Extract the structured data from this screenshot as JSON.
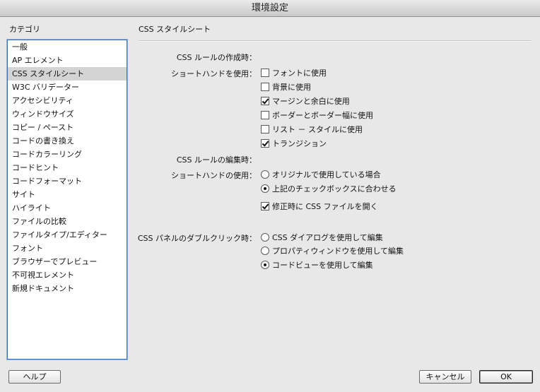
{
  "window": {
    "title": "環境設定"
  },
  "sidebar": {
    "label": "カテゴリ",
    "items": [
      {
        "label": "一般"
      },
      {
        "label": "AP エレメント"
      },
      {
        "label": "CSS スタイルシート"
      },
      {
        "label": "W3C バリデーター"
      },
      {
        "label": "アクセシビリティ"
      },
      {
        "label": "ウィンドウサイズ"
      },
      {
        "label": "コピー / ペースト"
      },
      {
        "label": "コードの書き換え"
      },
      {
        "label": "コードカラーリング"
      },
      {
        "label": "コードヒント"
      },
      {
        "label": "コードフォーマット"
      },
      {
        "label": "サイト"
      },
      {
        "label": "ハイライト"
      },
      {
        "label": "ファイルの比較"
      },
      {
        "label": "ファイルタイプ/エディター"
      },
      {
        "label": "フォント"
      },
      {
        "label": "ブラウザーでプレビュー"
      },
      {
        "label": "不可視エレメント"
      },
      {
        "label": "新規ドキュメント"
      }
    ],
    "selected_index": 2
  },
  "panel": {
    "title": "CSS スタイルシート",
    "create_heading": "CSS ルールの作成時：",
    "shorthand_use_label": "ショートハンドを使用：",
    "shorthand_options": [
      {
        "label": "フォントに使用",
        "checked": false
      },
      {
        "label": "背景に使用",
        "checked": false
      },
      {
        "label": "マージンと余白に使用",
        "checked": true
      },
      {
        "label": "ボーダーとボーダー幅に使用",
        "checked": false
      },
      {
        "label": "リスト － スタイルに使用",
        "checked": false
      },
      {
        "label": "トランジション",
        "checked": true
      }
    ],
    "edit_heading": "CSS ルールの編集時：",
    "shorthand_when_label": "ショートハンドの使用：",
    "edit_radios": [
      {
        "label": "オリジナルで使用している場合",
        "selected": false
      },
      {
        "label": "上記のチェックボックスに合わせる",
        "selected": true
      }
    ],
    "open_css_option": {
      "label": "修正時に CSS ファイルを開く",
      "checked": true
    },
    "dblclick_label": "CSS パネルのダブルクリック時：",
    "dblclick_radios": [
      {
        "label": "CSS ダイアログを使用して編集",
        "selected": false
      },
      {
        "label": "プロパティウィンドウを使用して編集",
        "selected": false
      },
      {
        "label": "コードビューを使用して編集",
        "selected": true
      }
    ]
  },
  "buttons": {
    "help": "ヘルプ",
    "cancel": "キャンセル",
    "ok": "OK"
  }
}
